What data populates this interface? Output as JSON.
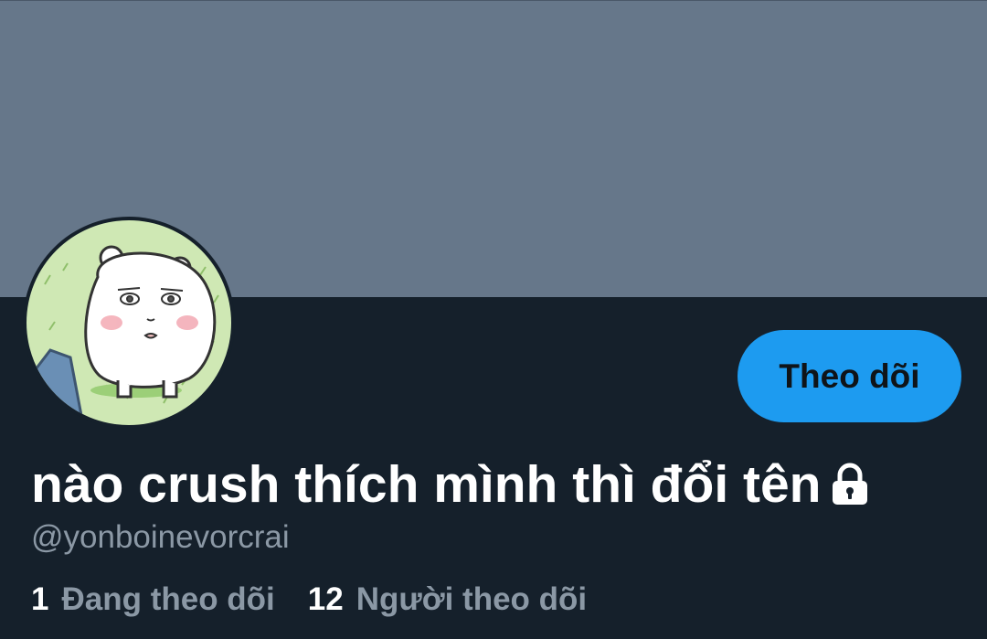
{
  "profile": {
    "display_name": "nào crush thích mình thì đổi tên",
    "handle": "@yonboinevorcrai",
    "protected_icon": "lock-icon",
    "avatar_icon": "cartoon-bear-avatar"
  },
  "actions": {
    "follow_label": "Theo dõi"
  },
  "stats": {
    "following_count": "1",
    "following_label": "Đang theo dõi",
    "followers_count": "12",
    "followers_label": "Người theo dõi"
  },
  "colors": {
    "background": "#15202b",
    "banner": "#66778a",
    "accent": "#1d9bf0",
    "secondary_text": "#8b98a5",
    "primary_text": "#ffffff"
  }
}
